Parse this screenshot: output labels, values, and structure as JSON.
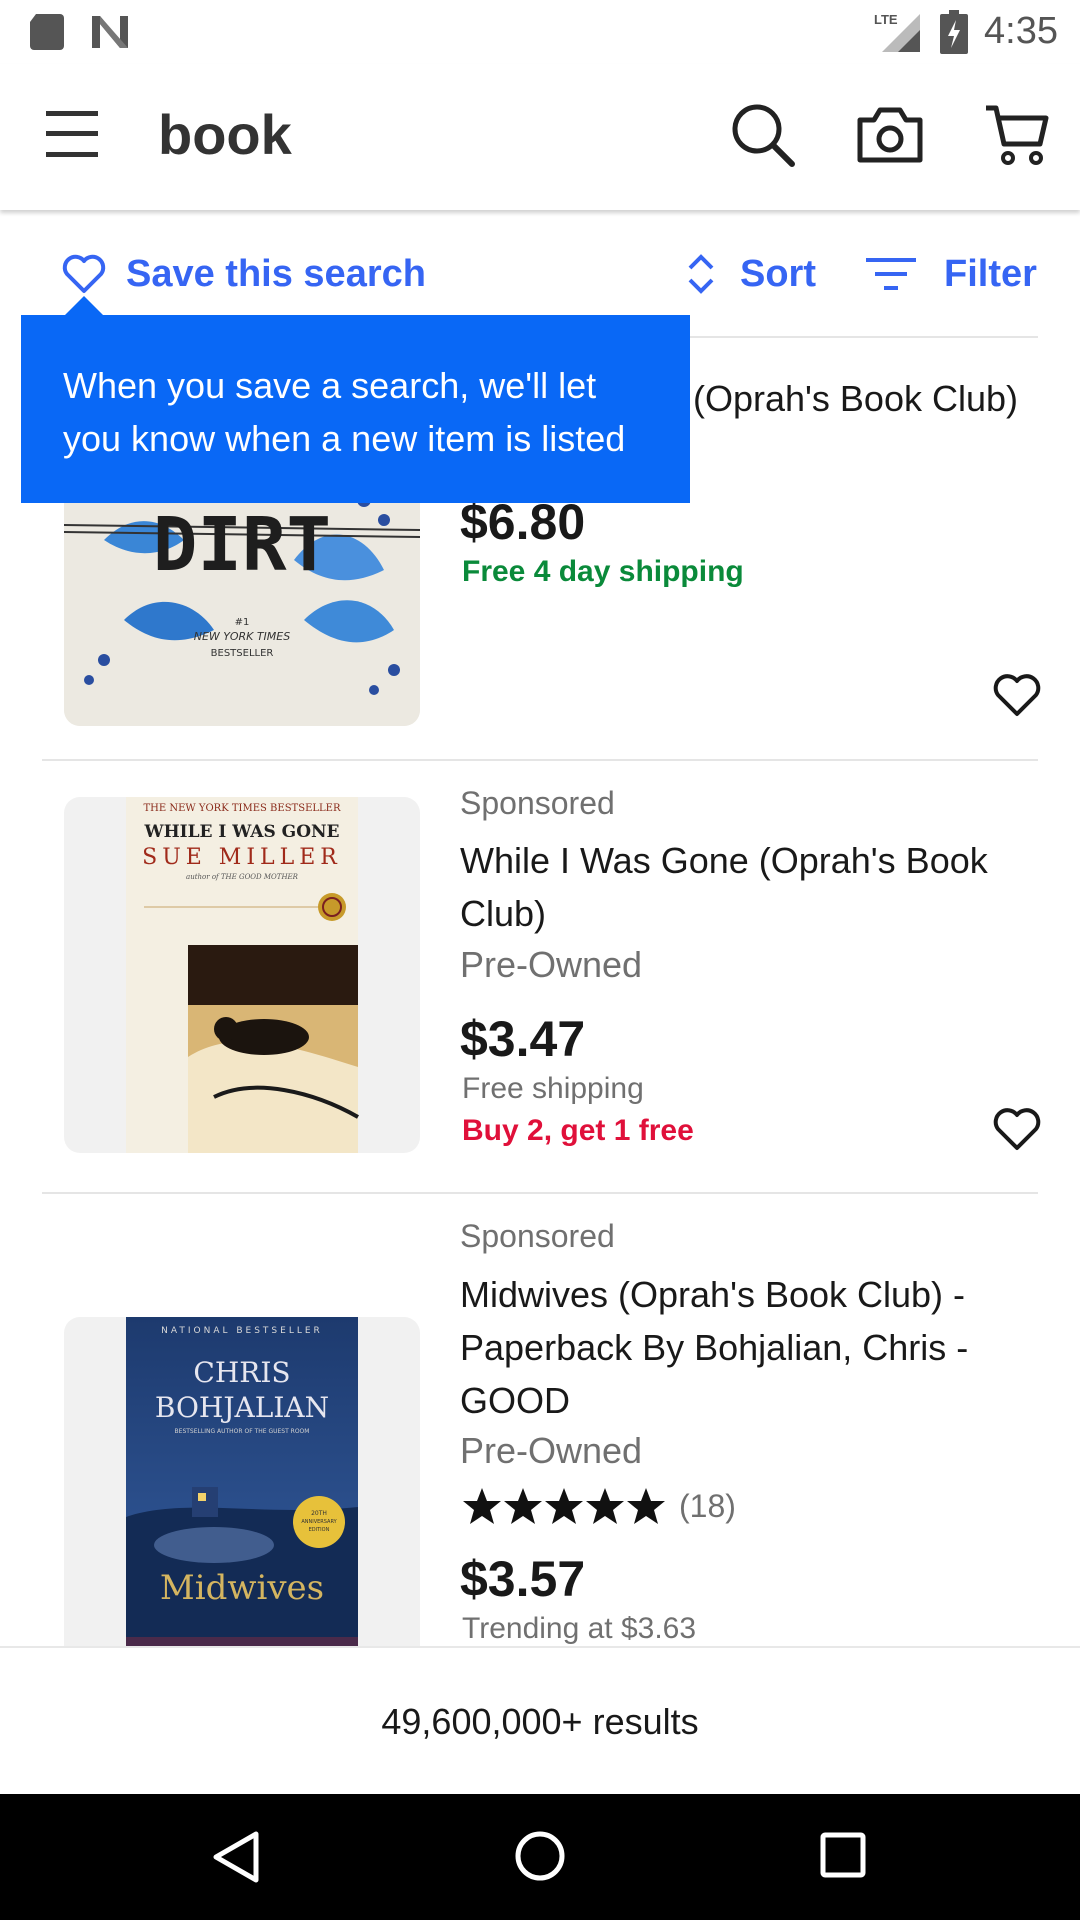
{
  "status_bar": {
    "time": "4:35",
    "network": "LTE"
  },
  "header": {
    "query": "book"
  },
  "toolbar": {
    "save_label": "Save this search",
    "sort_label": "Sort",
    "filter_label": "Filter"
  },
  "tooltip": {
    "text": "When you save a search, we'll let you know when a new item is listed"
  },
  "listings": [
    {
      "title_visible": "(Oprah's Book Club)",
      "price": "$6.80",
      "shipping": "Free 4 day shipping",
      "cover": {
        "title": "DIRT",
        "line1": "#1",
        "line2": "NEW YORK TIMES",
        "line3": "BESTSELLER"
      }
    },
    {
      "sponsored": "Sponsored",
      "title": "While I Was Gone (Oprah's Book Club)",
      "condition": "Pre-Owned",
      "price": "$3.47",
      "shipping": "Free shipping",
      "promo": "Buy 2, get 1 free",
      "cover": {
        "banner": "THE NEW YORK TIMES BESTSELLER",
        "title": "WHILE I WAS GONE",
        "author": "SUE MILLER",
        "subtitle": "author of THE GOOD MOTHER"
      }
    },
    {
      "sponsored": "Sponsored",
      "title": "Midwives (Oprah's Book Club) - Paperback By Bohjalian, Chris - GOOD",
      "condition": "Pre-Owned",
      "rating": 5,
      "review_count": "(18)",
      "price": "$3.57",
      "trending": "Trending at $3.63",
      "cover": {
        "banner": "NATIONAL BESTSELLER",
        "author1": "CHRIS",
        "author2": "BOHJALIAN",
        "subtitle": "BESTSELLING AUTHOR OF THE GUEST ROOM",
        "title": "Midwives",
        "badge1": "20TH",
        "badge2": "ANNIVERSARY",
        "badge3": "EDITION"
      }
    }
  ],
  "results": {
    "count_text": "49,600,000+ results"
  },
  "colors": {
    "accent": "#3665f3",
    "tooltip": "#0968f6",
    "green": "#0a8a3a",
    "promo": "#e0103a"
  },
  "icons": [
    "menu-icon",
    "search-icon",
    "camera-icon",
    "cart-icon",
    "heart-icon",
    "sort-icon",
    "filter-icon",
    "star-icon",
    "back-icon",
    "home-icon",
    "recents-icon"
  ]
}
